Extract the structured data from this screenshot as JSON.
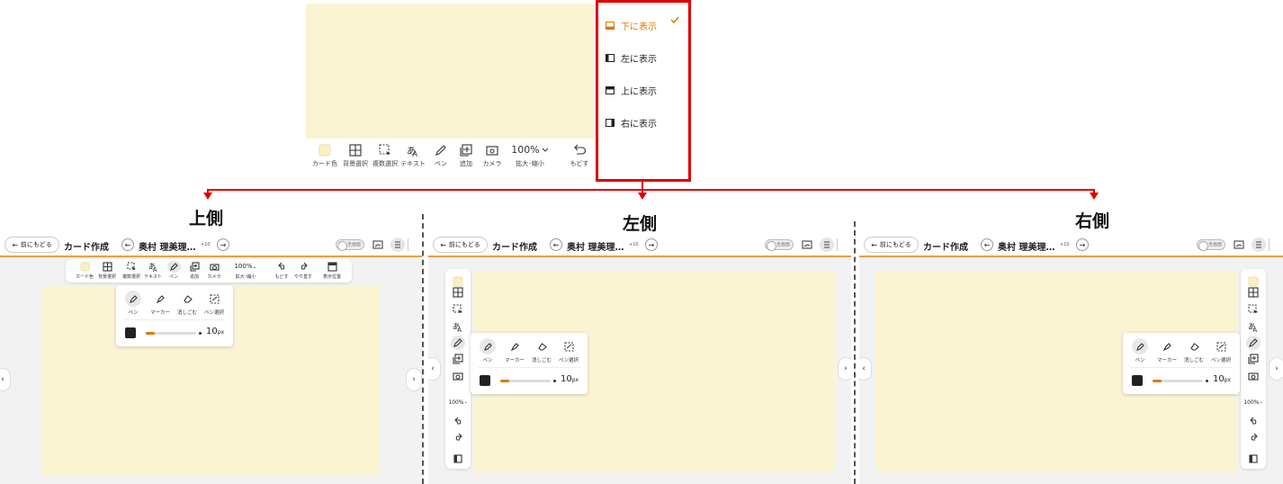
{
  "top_toolbar": {
    "items": [
      {
        "label": "カード色",
        "icon": "card-color-icon"
      },
      {
        "label": "背景選択",
        "icon": "grid-icon"
      },
      {
        "label": "複数選択",
        "icon": "multi-select-icon"
      },
      {
        "label": "テキスト",
        "icon": "text-icon"
      },
      {
        "label": "ペン",
        "icon": "pen-icon"
      },
      {
        "label": "追加",
        "icon": "add-icon"
      },
      {
        "label": "カメラ",
        "icon": "camera-icon"
      },
      {
        "label": "拡大･縮小",
        "icon": "zoom-icon"
      },
      {
        "label": "もどす",
        "icon": "undo-icon"
      },
      {
        "label": "やり直す",
        "icon": "redo-icon"
      },
      {
        "label": "表示位置",
        "icon": "position-icon"
      }
    ],
    "zoom_value": "100%"
  },
  "position_menu": {
    "items": [
      {
        "label": "下に表示",
        "selected": true
      },
      {
        "label": "左に表示",
        "selected": false
      },
      {
        "label": "上に表示",
        "selected": false
      },
      {
        "label": "右に表示",
        "selected": false
      }
    ]
  },
  "annotations": {
    "top": "上側",
    "left": "左側",
    "right": "右側"
  },
  "screen": {
    "back_label": "前にもどる",
    "page_title": "カード作成",
    "user_name": "奥村 理美理…",
    "badge": "+10",
    "toggle_label": "全画面",
    "zoom_value": "100%"
  },
  "pen_panel": {
    "tools": [
      "ペン",
      "マーカー",
      "消しごむ",
      "ペン選択"
    ],
    "size_value": "10",
    "size_unit": "px"
  },
  "colors": {
    "accent": "#e07800",
    "annotation_red": "#e00000",
    "card": "#fbf4d3"
  }
}
